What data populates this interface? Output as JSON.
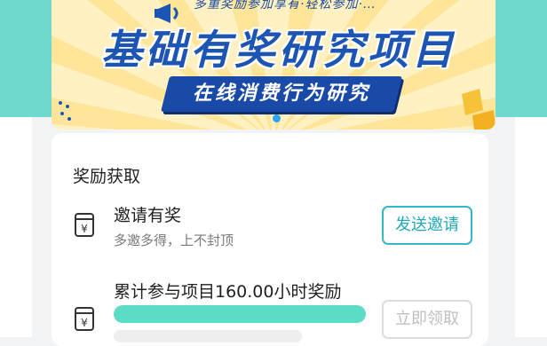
{
  "banner": {
    "subtitle": "多重奖励参加享有·轻松参加·…",
    "title": "基础有奖研究项目",
    "ribbon": "在线消费行为研究"
  },
  "rewards": {
    "section_title": "奖励获取",
    "invite": {
      "title": "邀请有奖",
      "desc": "多邀多得，上不封顶",
      "button": "发送邀请"
    },
    "hours": {
      "title": "累计参与项目160.00小时奖励",
      "progress": 1.0,
      "button": "立即领取"
    }
  },
  "colors": {
    "teal": "#6fd9cf",
    "brand_blue": "#1d55b4",
    "accent": "#35b7c6",
    "progress": "#5cdcc7"
  },
  "icons": [
    "megaphone-icon",
    "wallet-yen-icon"
  ]
}
